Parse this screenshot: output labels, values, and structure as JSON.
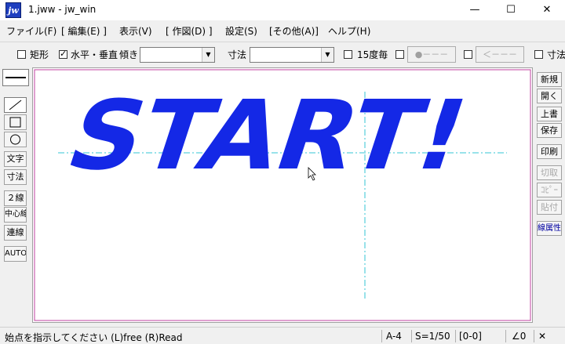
{
  "window": {
    "app_icon": "jw",
    "title": "1.jww - jw_win",
    "minimize": "—",
    "maximize": "☐",
    "close": "✕"
  },
  "menu": [
    "ファイル(F)",
    "[ 編集(E) ]",
    "表示(V)",
    "[ 作図(D) ]",
    "設定(S)",
    "[その他(A)]",
    "ヘルプ(H)"
  ],
  "toolbar": {
    "rect_label": "矩形",
    "rect_checked": false,
    "hv_label": "水平・垂直",
    "hv_checked": true,
    "angle_label": "傾き",
    "angle_value": "",
    "dim_label": "寸法",
    "dim_value": "",
    "deg15_label": "15度毎",
    "deg15_checked": false,
    "btn_circle": "●－－－",
    "btn_arrow": "＜－－－",
    "right_label": "寸法"
  },
  "left_tools": [
    "文字",
    "寸法",
    "２線",
    "中心線",
    "連線",
    "AUTO"
  ],
  "right_commands": [
    "新規",
    "開く",
    "上書",
    "保存",
    "印刷",
    "切取",
    "ｺﾋﾟｰ",
    "貼付",
    "線属性"
  ],
  "canvas": {
    "drawing_text": "START!",
    "text_color": "#1428e6",
    "aux_line_color": "#33c6d6",
    "border_color": "#c040a0"
  },
  "status": {
    "message": "始点を指示してください (L)free (R)Read",
    "paper": "A-4",
    "scale": "S=1/50",
    "layer": "[0-0]",
    "angle": "∠0",
    "cross": "✕"
  }
}
